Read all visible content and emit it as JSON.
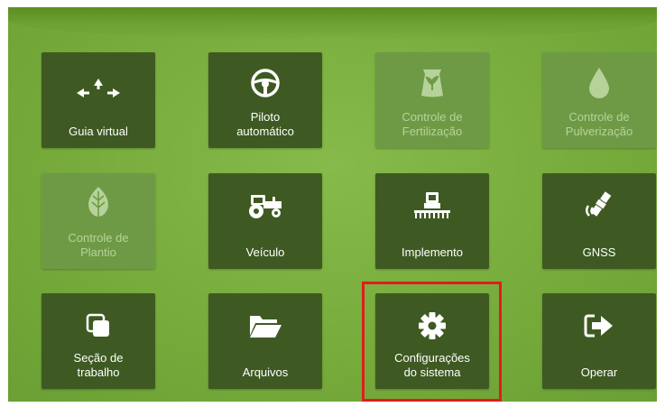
{
  "tiles": [
    {
      "id": "guia-virtual",
      "label": "Guia virtual",
      "icon": "arrows-icon",
      "enabled": true
    },
    {
      "id": "piloto-automatico",
      "label": "Piloto\nautomático",
      "icon": "steering-wheel-icon",
      "enabled": true
    },
    {
      "id": "controle-fertilizacao",
      "label": "Controle de\nFertilização",
      "icon": "fertilizer-bag-icon",
      "enabled": false
    },
    {
      "id": "controle-pulverizacao",
      "label": "Controle de\nPulverização",
      "icon": "droplet-icon",
      "enabled": false
    },
    {
      "id": "controle-plantio",
      "label": "Controle de\nPlantio",
      "icon": "leaf-icon",
      "enabled": false
    },
    {
      "id": "veiculo",
      "label": "Veículo",
      "icon": "tractor-icon",
      "enabled": true
    },
    {
      "id": "implemento",
      "label": "Implemento",
      "icon": "implement-icon",
      "enabled": true
    },
    {
      "id": "gnss",
      "label": "GNSS",
      "icon": "satellite-icon",
      "enabled": true
    },
    {
      "id": "secao-trabalho",
      "label": "Seção de\ntrabalho",
      "icon": "sections-icon",
      "enabled": true
    },
    {
      "id": "arquivos",
      "label": "Arquivos",
      "icon": "folder-icon",
      "enabled": true
    },
    {
      "id": "configuracoes-sistema",
      "label": "Configurações\ndo sistema",
      "icon": "gear-icon",
      "enabled": true
    },
    {
      "id": "operar",
      "label": "Operar",
      "icon": "exit-arrow-icon",
      "enabled": true
    }
  ],
  "colors": {
    "background": "#7db141",
    "tile": "#3e5a22",
    "tile_disabled": "#6f9a45",
    "highlight": "#e21c1c"
  },
  "highlighted_tile": "configuracoes-sistema"
}
